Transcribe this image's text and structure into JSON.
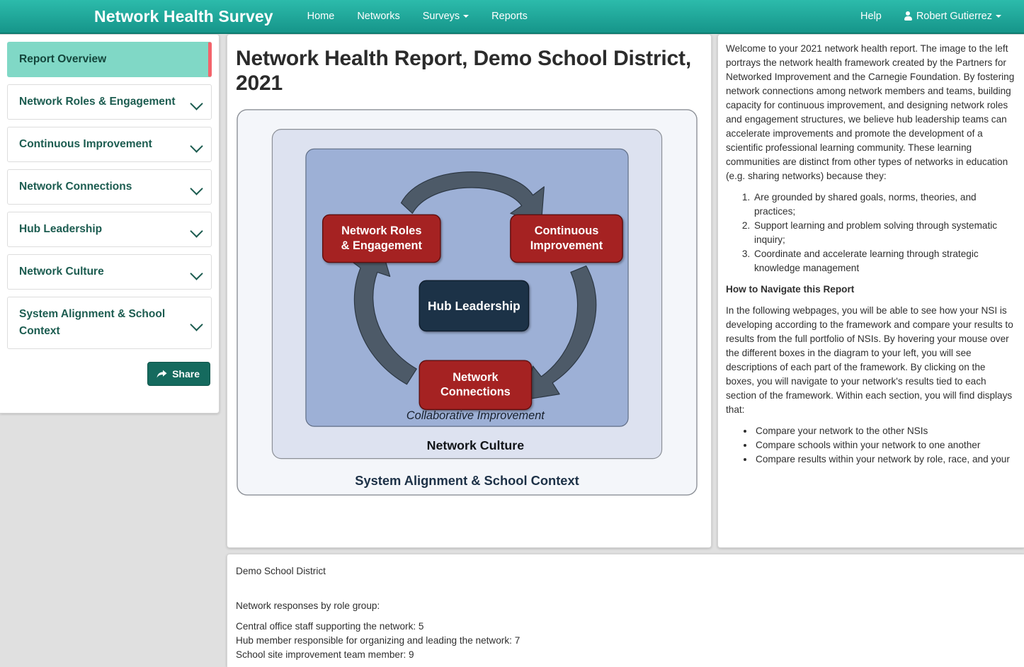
{
  "navbar": {
    "brand": "Network Health Survey",
    "links": [
      {
        "label": "Home",
        "caret": false
      },
      {
        "label": "Networks",
        "caret": false
      },
      {
        "label": "Surveys",
        "caret": true
      },
      {
        "label": "Reports",
        "caret": false
      }
    ],
    "help": "Help",
    "user": "Robert Gutierrez",
    "colors": {
      "gradient_top": "#2cbbab",
      "gradient_bottom": "#16958a"
    }
  },
  "sidebar": {
    "items": [
      {
        "label": "Report Overview",
        "active": true,
        "chevron": false
      },
      {
        "label": "Network Roles & Engagement",
        "active": false,
        "chevron": true
      },
      {
        "label": "Continuous Improvement",
        "active": false,
        "chevron": true
      },
      {
        "label": "Network Connections",
        "active": false,
        "chevron": true
      },
      {
        "label": "Hub Leadership",
        "active": false,
        "chevron": true
      },
      {
        "label": "Network Culture",
        "active": false,
        "chevron": true
      },
      {
        "label": "System Alignment & School Context",
        "active": false,
        "chevron": true
      }
    ],
    "share_label": "Share",
    "colors": {
      "active_bg": "#80d8c6",
      "active_marker": "#f4636b",
      "share_bg": "#156a5e"
    }
  },
  "main": {
    "title": "Network Health Report, Demo School District, 2021",
    "diagram": {
      "outer_label": "System Alignment & School Context",
      "middle_label": "Network Culture",
      "inner_label": "Collaborative Improvement",
      "boxes": [
        {
          "id": "network-roles",
          "label": "Network Roles\n& Engagement",
          "line1": "Network Roles",
          "line2": "& Engagement",
          "color": "#a52121"
        },
        {
          "id": "continuous-improvement",
          "label": "Continuous Improvement",
          "line1": "Continuous",
          "line2": "Improvement",
          "color": "#a52121"
        },
        {
          "id": "network-connections",
          "label": "Network Connections",
          "line1": "Network",
          "line2": "Connections",
          "color": "#a52121"
        },
        {
          "id": "hub-leadership",
          "label": "Hub Leadership",
          "line1": "Hub Leadership",
          "line2": "",
          "color": "#1d3147"
        }
      ],
      "colors": {
        "outer_bg": "#f4f6fa",
        "middle_bg": "#dde2f0",
        "inner_bg": "#9db0d6",
        "arrow": "#4d5a68",
        "red_box": "#a52121",
        "hub_box": "#1d3147"
      }
    }
  },
  "info": {
    "paragraph1": "Welcome to your 2021 network health report. The image to the left portrays the network health framework created by the Partners for Networked Improvement and the Carnegie Foundation. By fostering network connections among network members and teams, building capacity for continuous improvement, and designing network roles and engagement structures, we believe hub leadership teams can accelerate improvements and promote the development of a scientific professional learning community. These learning communities are distinct from other types of networks in education (e.g. sharing networks) because they:",
    "ordered_list": [
      "Are grounded by shared goals, norms, theories, and practices;",
      "Support learning and problem solving through systematic inquiry;",
      "Coordinate and accelerate learning through strategic knowledge management"
    ],
    "heading": "How to Navigate this Report",
    "paragraph2": "In the following webpages, you will be able to see how your NSI is developing according to the framework and compare your results to results from the full portfolio of NSIs. By hovering your mouse over the different boxes in the diagram to your left, you will see descriptions of each part of the framework. By clicking on the boxes, you will navigate to your network's results tied to each section of the framework. Within each section, you will find displays that:",
    "bullet_list": [
      "Compare your network to the other NSIs",
      "Compare schools within your network to one another",
      "Compare results within your network by role, race, and your"
    ]
  },
  "bottom": {
    "district": "Demo School District",
    "responses_heading": "Network responses by role group:",
    "rows": [
      "Central office staff supporting the network: 5",
      "Hub member responsible for organizing and leading the network: 7",
      "School site improvement team member: 9"
    ]
  }
}
